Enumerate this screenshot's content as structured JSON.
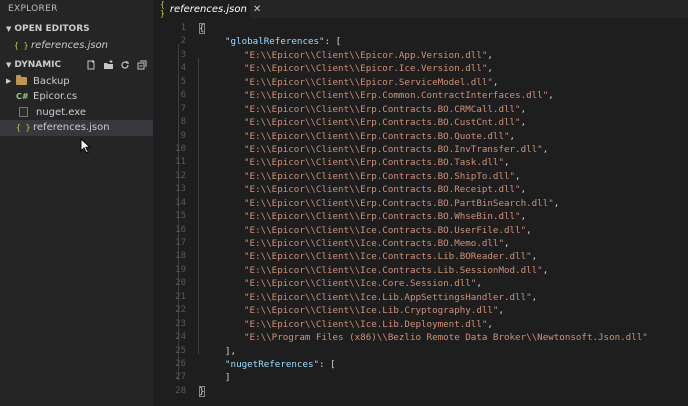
{
  "sidebar": {
    "title": "EXPLORER",
    "open_editors": {
      "label": "OPEN EDITORS",
      "items": [
        {
          "icon": "json-icon",
          "label": "references.json"
        }
      ]
    },
    "workspace": {
      "label": "DYNAMIC",
      "actions": [
        "new-file-icon",
        "new-folder-icon",
        "refresh-icon",
        "collapse-all-icon"
      ],
      "items": [
        {
          "icon": "folder-icon",
          "label": "Backup",
          "type": "folder"
        },
        {
          "icon": "csharp-icon",
          "icon_text": "C#",
          "label": "Epicor.cs",
          "type": "file"
        },
        {
          "icon": "exe-icon",
          "label": "nuget.exe",
          "type": "file"
        },
        {
          "icon": "json-icon",
          "icon_text": "{ }",
          "label": "references.json",
          "type": "file",
          "selected": true
        }
      ]
    }
  },
  "tab": {
    "icon_text": "{ }",
    "label": "references.json",
    "close": "✕"
  },
  "editor": {
    "line_numbers": [
      "1",
      "2",
      "3",
      "4",
      "5",
      "6",
      "7",
      "8",
      "9",
      "10",
      "11",
      "12",
      "13",
      "14",
      "15",
      "16",
      "17",
      "18",
      "19",
      "20",
      "21",
      "22",
      "23",
      "24",
      "25",
      "26",
      "27",
      "28"
    ],
    "open_brace": "{",
    "close_brace": "}",
    "global_key": "\"globalReferences\"",
    "global_open": ": [",
    "global_close": "],",
    "global_references": [
      "\"E:\\\\Epicor\\\\Client\\\\Epicor.App.Version.dll\",",
      "\"E:\\\\Epicor\\\\Client\\\\Epicor.Ice.Version.dll\",",
      "\"E:\\\\Epicor\\\\Client\\\\Epicor.ServiceModel.dll\",",
      "\"E:\\\\Epicor\\\\Client\\\\Erp.Common.ContractInterfaces.dll\",",
      "\"E:\\\\Epicor\\\\Client\\\\Erp.Contracts.BO.CRMCall.dll\",",
      "\"E:\\\\Epicor\\\\Client\\\\Erp.Contracts.BO.CustCnt.dll\",",
      "\"E:\\\\Epicor\\\\Client\\\\Erp.Contracts.BO.Quote.dll\",",
      "\"E:\\\\Epicor\\\\Client\\\\Erp.Contracts.BO.InvTransfer.dll\",",
      "\"E:\\\\Epicor\\\\Client\\\\Erp.Contracts.BO.Task.dll\",",
      "\"E:\\\\Epicor\\\\Client\\\\Erp.Contracts.BO.ShipTo.dll\",",
      "\"E:\\\\Epicor\\\\Client\\\\Erp.Contracts.BO.Receipt.dll\",",
      "\"E:\\\\Epicor\\\\Client\\\\Erp.Contracts.BO.PartBinSearch.dll\",",
      "\"E:\\\\Epicor\\\\Client\\\\Erp.Contracts.BO.WhseBin.dll\",",
      "\"E:\\\\Epicor\\\\Client\\\\Ice.Contracts.BO.UserFile.dll\",",
      "\"E:\\\\Epicor\\\\Client\\\\Ice.Contracts.BO.Memo.dll\",",
      "\"E:\\\\Epicor\\\\Client\\\\Ice.Contracts.Lib.BOReader.dll\",",
      "\"E:\\\\Epicor\\\\Client\\\\Ice.Contracts.Lib.SessionMod.dll\",",
      "\"E:\\\\Epicor\\\\Client\\\\Ice.Core.Session.dll\",",
      "\"E:\\\\Epicor\\\\Client\\\\Ice.Lib.AppSettingsHandler.dll\",",
      "\"E:\\\\Epicor\\\\Client\\\\Ice.Lib.Cryptography.dll\",",
      "\"E:\\\\Epicor\\\\Client\\\\Ice.Lib.Deployment.dll\",",
      "\"E:\\\\Program Files (x86)\\\\Bezlio Remote Data Broker\\\\Newtonsoft.Json.dll\""
    ],
    "nuget_key": "\"nugetReferences\"",
    "nuget_open": ": [",
    "nuget_close": "]"
  },
  "colors": {
    "background": "#1e1e1e",
    "sidebar": "#252526",
    "key": "#9cdcfe",
    "string": "#ce9178",
    "json_icon": "#cbcb41",
    "csharp_icon": "#89d185",
    "folder_icon": "#c09553"
  }
}
